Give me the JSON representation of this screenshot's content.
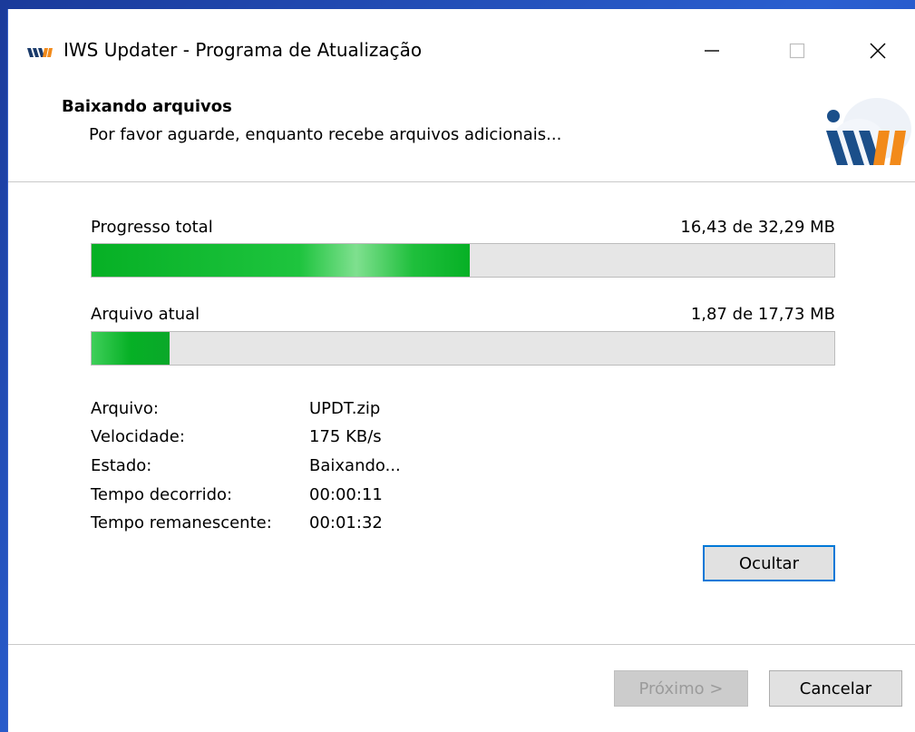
{
  "window": {
    "title": "IWS Updater - Programa de Atualização",
    "icon": "iws-logo-icon",
    "controls": {
      "minimize": "minimize-icon",
      "maximize": "maximize-icon",
      "close": "close-icon"
    }
  },
  "header": {
    "title": "Baixando arquivos",
    "subtitle": "Por favor aguarde, enquanto recebe arquivos adicionais...",
    "logo": "iws-logo"
  },
  "progress": {
    "total": {
      "label": "Progresso total",
      "value_text": "16,43 de 32,29 MB",
      "percent": 50.9
    },
    "current": {
      "label": "Arquivo atual",
      "value_text": "1,87 de 17,73 MB",
      "percent": 10.5
    }
  },
  "details": [
    {
      "label": "Arquivo:",
      "value": "UPDT.zip"
    },
    {
      "label": "Velocidade:",
      "value": "175 KB/s"
    },
    {
      "label": "Estado:",
      "value": "Baixando..."
    },
    {
      "label": "Tempo decorrido:",
      "value": "00:00:11"
    },
    {
      "label": "Tempo remanescente:",
      "value": "00:01:32"
    }
  ],
  "buttons": {
    "hide": "Ocultar",
    "next": "Próximo >",
    "cancel": "Cancelar"
  },
  "colors": {
    "progress_green": "#06b025",
    "focus_border": "#0078d7",
    "desktop_blue": "#1c46b8"
  }
}
